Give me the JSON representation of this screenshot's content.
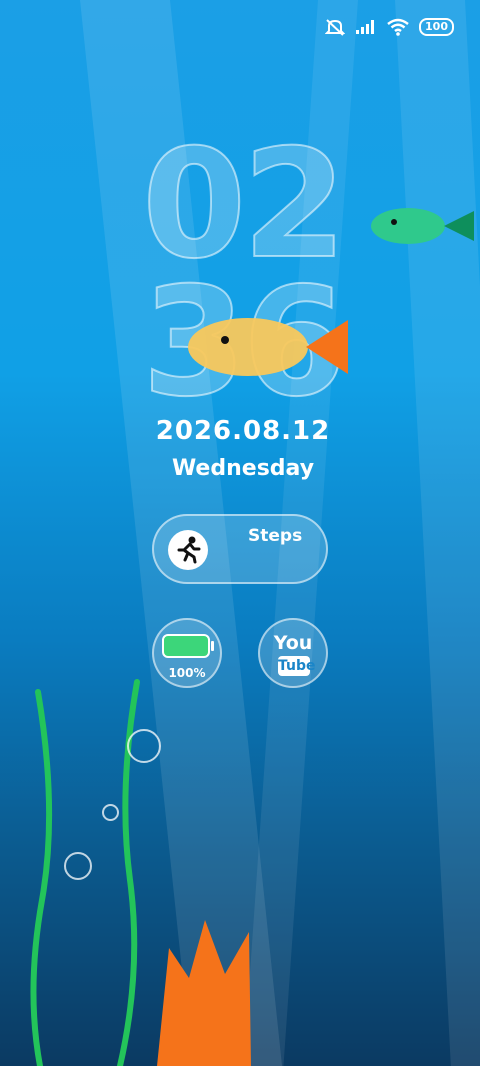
{
  "status_bar": {
    "icons": [
      "mute-icon",
      "signal-icon",
      "wifi-icon"
    ],
    "battery_level": "100"
  },
  "clock": {
    "hour": "02",
    "minute": "36"
  },
  "date": {
    "full": "2026.08.12",
    "weekday": "Wednesday"
  },
  "widgets": {
    "steps": {
      "label": "Steps",
      "icon": "running-person-icon"
    },
    "battery": {
      "percent_text": "100%",
      "level": 1.0,
      "color": "#3cd67a"
    },
    "youtube": {
      "line1": "You",
      "line2": "Tube"
    }
  },
  "colors": {
    "accent_fish_yellow": "#f9c85c",
    "accent_fish_green": "#2fc98c",
    "coral": "#f5731a",
    "seaweed": "#23c45a"
  }
}
